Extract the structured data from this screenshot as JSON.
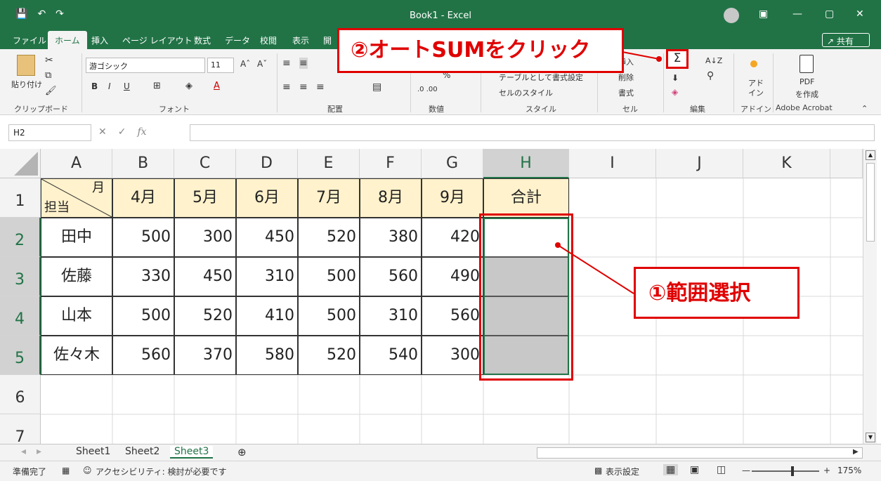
{
  "app": {
    "title": "Book1  -  Excel"
  },
  "ribbon_tabs": [
    "ファイル",
    "ホーム",
    "挿入",
    "ページ レイアウト",
    "数式",
    "データ",
    "校閲",
    "表示",
    "開"
  ],
  "share_label": "共有",
  "ribbon": {
    "paste_label": "貼り付け",
    "font_name": "游ゴシック",
    "font_size": "11",
    "group_clipboard": "クリップボード",
    "group_font": "フォント",
    "group_alignment": "配置",
    "group_number": "数値",
    "group_styles": "スタイル",
    "group_cells": "セル",
    "group_editing": "編集",
    "group_addins": "アドイン",
    "group_acrobat": "Adobe Acrobat",
    "table_format": "テーブルとして書式設定",
    "cell_styles": "セルのスタイル",
    "insert": "挿入",
    "delete": "削除",
    "format": "書式",
    "addin_label": "アド イン",
    "pdf_label": "PDF",
    "pdf_create": "を作成",
    "autosum_symbol": "Σ"
  },
  "formula_bar": {
    "name_box": "H2",
    "formula": ""
  },
  "columns": [
    "A",
    "B",
    "C",
    "D",
    "E",
    "F",
    "G",
    "H",
    "I",
    "J",
    "K"
  ],
  "rows": [
    "1",
    "2",
    "3",
    "4",
    "5",
    "6",
    "7"
  ],
  "table": {
    "corner_top": "月",
    "corner_bottom": "担当",
    "months": [
      "4月",
      "5月",
      "6月",
      "7月",
      "8月",
      "9月"
    ],
    "total_header": "合計",
    "data": [
      {
        "name": "田中",
        "values": [
          "500",
          "300",
          "450",
          "520",
          "380",
          "420"
        ]
      },
      {
        "name": "佐藤",
        "values": [
          "330",
          "450",
          "310",
          "500",
          "560",
          "490"
        ]
      },
      {
        "name": "山本",
        "values": [
          "500",
          "520",
          "410",
          "500",
          "310",
          "560"
        ]
      },
      {
        "name": "佐々木",
        "values": [
          "560",
          "370",
          "580",
          "520",
          "540",
          "300"
        ]
      }
    ]
  },
  "annotations": {
    "step1": "①範囲選択",
    "step2": "②オートSUMをクリック"
  },
  "sheets": [
    "Sheet1",
    "Sheet2",
    "Sheet3"
  ],
  "status": {
    "ready": "準備完了",
    "accessibility": "アクセシビリティ: 検討が必要です",
    "display_settings": "表示設定",
    "zoom": "175%"
  },
  "colors": {
    "excel_green": "#217346",
    "header_fill": "#fff2cc",
    "selection_fill": "#c8c8c8",
    "annotation_red": "#e00000"
  }
}
